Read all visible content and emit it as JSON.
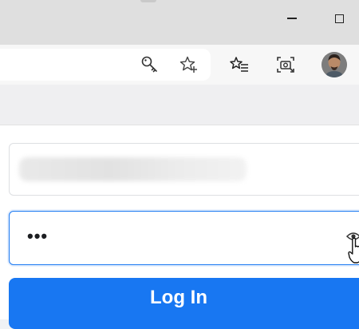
{
  "window": {
    "minimize_icon": "minimize-icon",
    "maximize_icon": "maximize-icon"
  },
  "toolbar": {
    "icons": [
      "key-icon",
      "star-add-icon",
      "favorites-icon",
      "screenshot-icon"
    ],
    "avatar": "profile-avatar"
  },
  "form": {
    "email_value": "",
    "password_value": "•••",
    "login_label": "Log In",
    "accent_color": "#1877f2"
  }
}
